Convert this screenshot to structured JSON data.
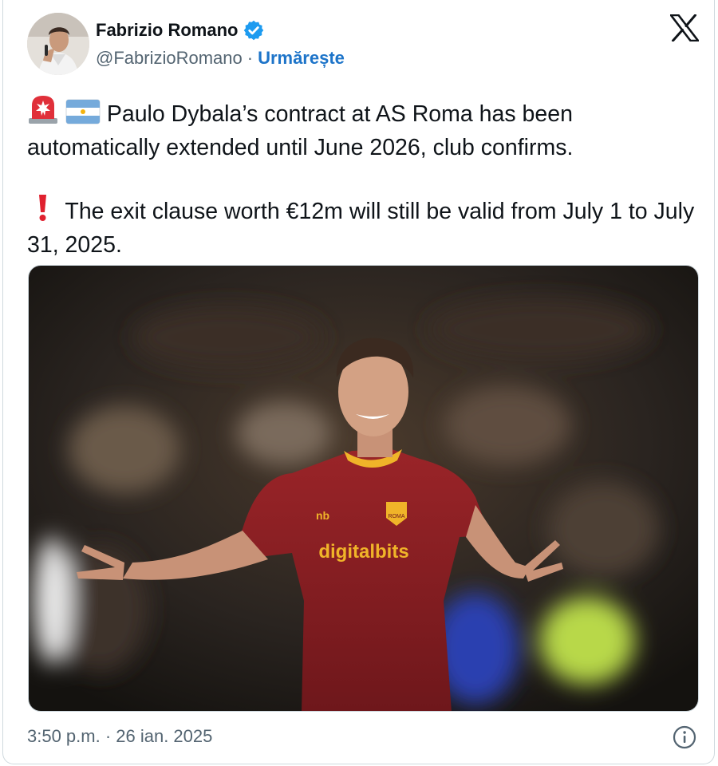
{
  "author": {
    "name": "Fabrizio Romano",
    "handle": "@FabrizioRomano",
    "separator": "·",
    "follow_label": "Urmărește",
    "verified_icon": "verified-badge-icon",
    "avatar_icon": "author-avatar"
  },
  "brand": {
    "logo_icon": "x-logo-icon"
  },
  "tweet": {
    "line1_emoji": [
      "rotating-light-emoji",
      "argentina-flag-emoji"
    ],
    "paragraph1": "Paulo Dybala’s contract at AS Roma has been automatically extended until June 2026, club confirms.",
    "line2_emoji": "exclamation-emoji",
    "paragraph2": "The exit clause worth €12m will still be valid from July 1 to July 31, 2025."
  },
  "media": {
    "jersey_sponsor": "digitalbits",
    "badge_text": "ROMA"
  },
  "footer": {
    "timestamp": "3:50 p.m. · 26 ian. 2025",
    "info_icon": "info-icon"
  },
  "colors": {
    "text": "#0f1419",
    "secondary": "#536471",
    "link": "#1d74c9",
    "verified": "#1d9bf0",
    "border": "#cfd9de",
    "jersey": "#8e1f24",
    "jersey_accent": "#f0b429"
  }
}
